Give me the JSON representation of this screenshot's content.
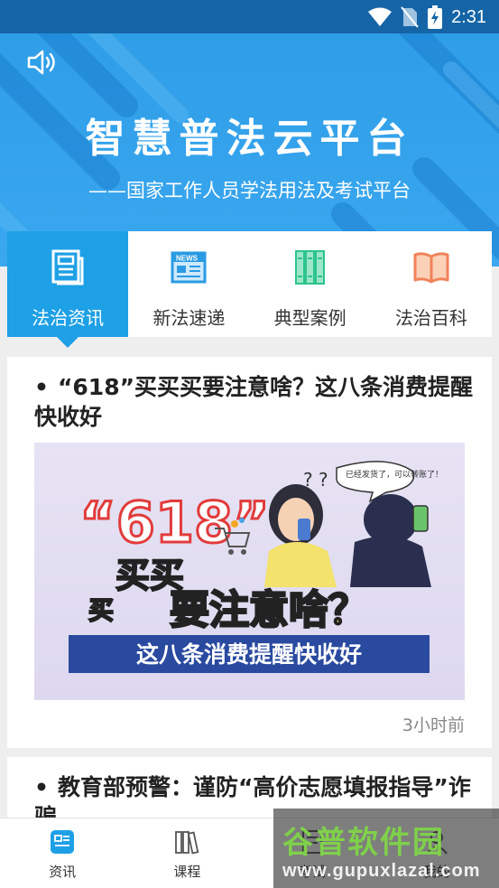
{
  "status_bar": {
    "time": "2:31"
  },
  "hero": {
    "title": "智慧普法云平台",
    "subtitle": "——国家工作人员学法用法及考试平台"
  },
  "tabs": [
    {
      "label": "法治资讯",
      "icon": "news-document-icon",
      "active": true
    },
    {
      "label": "新法速递",
      "icon": "newspaper-icon",
      "active": false
    },
    {
      "label": "典型案例",
      "icon": "case-folders-icon",
      "active": false
    },
    {
      "label": "法治百科",
      "icon": "open-book-icon",
      "active": false
    }
  ],
  "articles": [
    {
      "bullet": "•",
      "title": "“618”买买买要注意啥？这八条消费提醒快收好",
      "time": "3小时前",
      "thumbnail": {
        "big_number": "“618”",
        "line1": "买买",
        "line1b": "买",
        "line2": "要注意啥？",
        "banner": "这八条消费提醒快收好",
        "bubble": "已经发货了，可以转账了！",
        "question_marks": "? ?"
      }
    },
    {
      "bullet": "•",
      "title": "教育部预警：谨防“高价志愿填报指导”诈骗"
    }
  ],
  "bottom_nav": [
    {
      "label": "资讯",
      "icon": "news-icon"
    },
    {
      "label": "课程",
      "icon": "books-icon"
    },
    {
      "label": "考试",
      "icon": "exam-icon"
    },
    {
      "label": "我的",
      "icon": "user-icon"
    }
  ],
  "watermark": {
    "brand": "谷普软件园",
    "url": "www.gupuxlazal.com"
  },
  "colors": {
    "primary": "#1ea0e6",
    "status_bar": "#1565a6",
    "hero": "#2f9ee8"
  }
}
